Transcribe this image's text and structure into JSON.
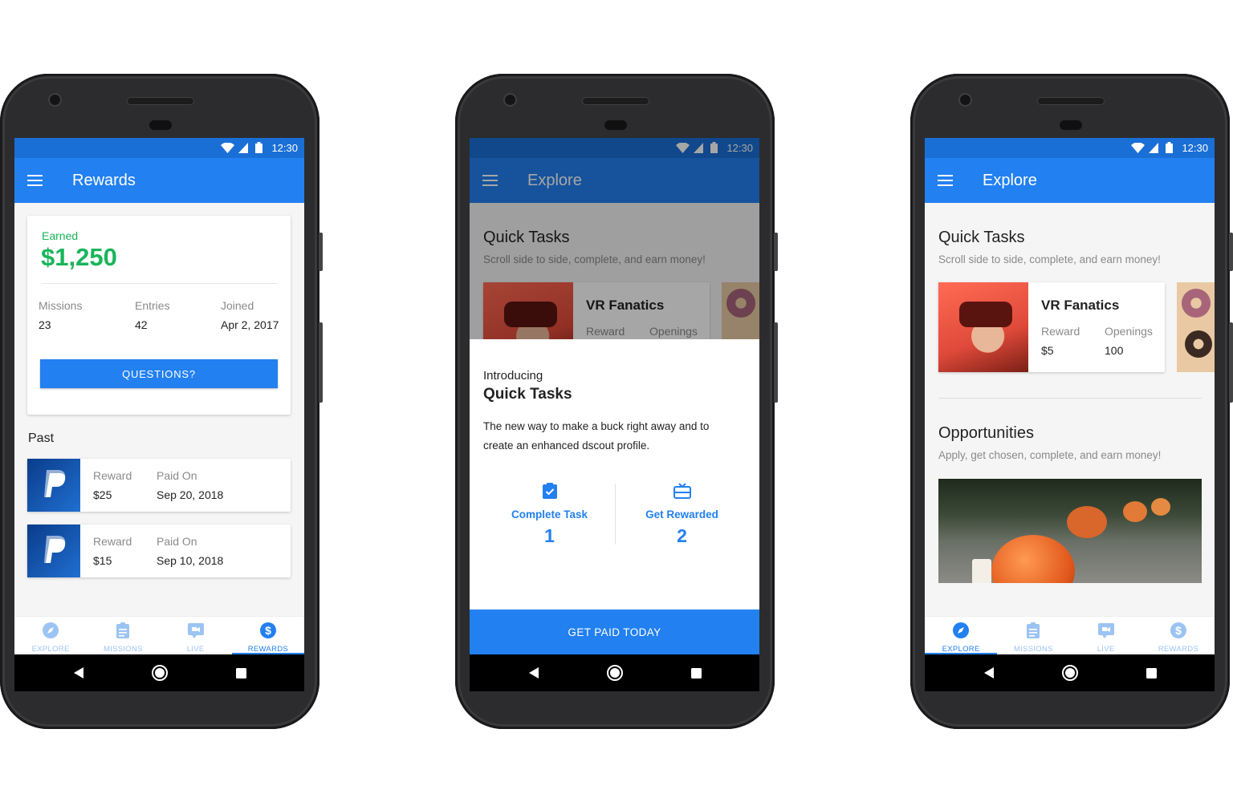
{
  "status": {
    "time": "12:30"
  },
  "phone1": {
    "title": "Rewards",
    "earned_label": "Earned",
    "earned_value": "$1,250",
    "stats": [
      {
        "label": "Missions",
        "value": "23"
      },
      {
        "label": "Entries",
        "value": "42"
      },
      {
        "label": "Joined",
        "value": "Apr 2, 2017"
      }
    ],
    "questions_button": "QUESTIONS?",
    "past_heading": "Past",
    "past_items": [
      {
        "reward_label": "Reward",
        "reward": "$25",
        "paid_label": "Paid On",
        "paid": "Sep 20, 2018"
      },
      {
        "reward_label": "Reward",
        "reward": "$15",
        "paid_label": "Paid On",
        "paid": "Sep 10, 2018"
      }
    ]
  },
  "phone2": {
    "title": "Explore",
    "section_title": "Quick Tasks",
    "section_sub": "Scroll side to side, complete, and earn money!",
    "card_title": "VR Fanatics",
    "card_reward_label": "Reward",
    "card_openings_label": "Openings",
    "intro_small": "Introducing",
    "intro_big": "Quick Tasks",
    "intro_body": "The new way to make a buck right away and to create an enhanced dscout profile.",
    "steps": [
      {
        "label": "Complete Task",
        "num": "1"
      },
      {
        "label": "Get Rewarded",
        "num": "2"
      }
    ],
    "cta": "GET PAID TODAY"
  },
  "phone3": {
    "title": "Explore",
    "section_title": "Quick Tasks",
    "section_sub": "Scroll side to side, complete, and earn money!",
    "card_title": "VR Fanatics",
    "card_reward_label": "Reward",
    "card_reward": "$5",
    "card_openings_label": "Openings",
    "card_openings": "100",
    "opps_title": "Opportunities",
    "opps_sub": "Apply, get chosen, complete, and earn money!"
  },
  "nav": {
    "explore": "EXPLORE",
    "missions": "MISSIONS",
    "live": "LIVE",
    "rewards": "REWARDS"
  },
  "colors": {
    "primary": "#2280f0",
    "statusbar": "#1a6fd6",
    "earned_green": "#19b55a"
  }
}
